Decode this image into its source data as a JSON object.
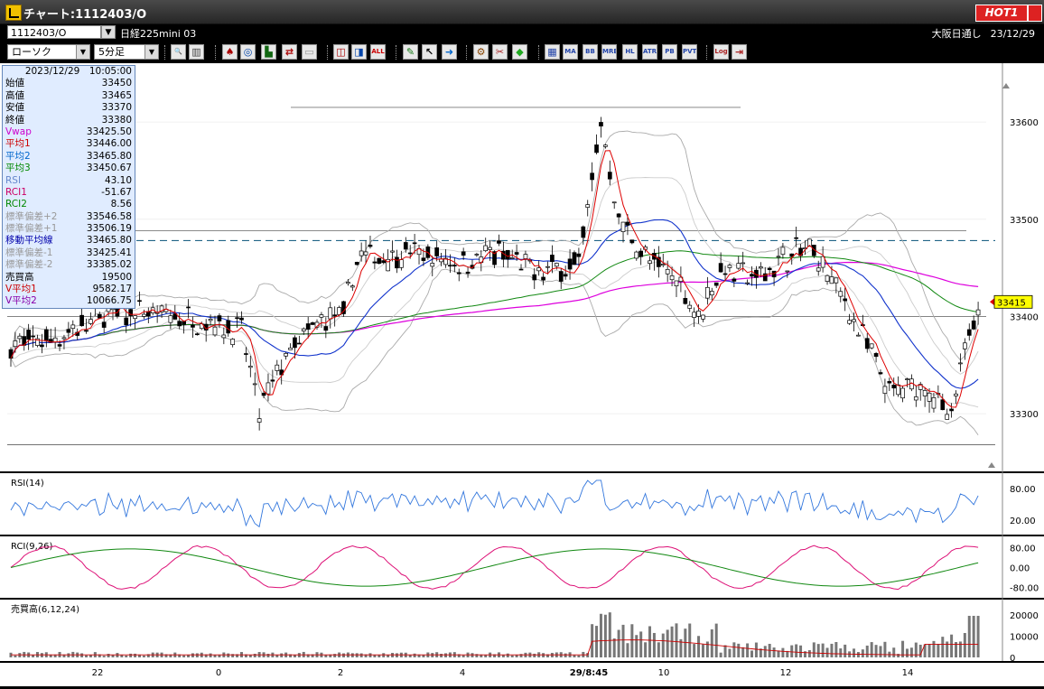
{
  "window": {
    "title": "チャート:1112403/O",
    "hot_label": "HOT1"
  },
  "header": {
    "code": "1112403/O",
    "name": "日経225mini 03",
    "market": "大阪日通し",
    "date": "23/12/29"
  },
  "toolbar": {
    "chart_type": "ローソク",
    "timeframe": "5分足",
    "buttons": [
      {
        "name": "zoom-icon",
        "glyph": "🔍",
        "color": "#2255cc"
      },
      {
        "name": "split-icon",
        "glyph": "▥",
        "color": "#444"
      },
      {
        "name": "candle-tool-icon",
        "glyph": "♠",
        "color": "#aa0000"
      },
      {
        "name": "magnifier-info-icon",
        "glyph": "◎",
        "color": "#0044aa"
      },
      {
        "name": "bar-chart-icon",
        "glyph": "▙",
        "color": "#116611"
      },
      {
        "name": "shuffle-icon",
        "glyph": "⇄",
        "color": "#aa0000"
      },
      {
        "name": "disabled-icon",
        "glyph": "▭",
        "color": "#999"
      },
      {
        "name": "candle-up-icon",
        "glyph": "◫",
        "color": "#aa0000"
      },
      {
        "name": "candle-down-icon",
        "glyph": "◨",
        "color": "#0044aa"
      },
      {
        "name": "all-icon",
        "glyph": "ALL",
        "color": "#cc0000"
      },
      {
        "name": "pen-icon",
        "glyph": "✎",
        "color": "#117711"
      },
      {
        "name": "cursor-icon",
        "glyph": "↖",
        "color": "#000"
      },
      {
        "name": "arrow-right-icon",
        "glyph": "➜",
        "color": "#0066cc"
      },
      {
        "name": "settings-icon",
        "glyph": "⚙",
        "color": "#884400"
      },
      {
        "name": "wrench-icon",
        "glyph": "✂",
        "color": "#aa2222"
      },
      {
        "name": "color-icon",
        "glyph": "◆",
        "color": "#22aa22"
      },
      {
        "name": "grid-icon",
        "glyph": "▦",
        "color": "#2244aa"
      },
      {
        "name": "ma-icon",
        "glyph": "MA",
        "color": "#2244aa"
      },
      {
        "name": "bb-icon",
        "glyph": "BB",
        "color": "#2244aa"
      },
      {
        "name": "mre-icon",
        "glyph": "MRE",
        "color": "#2244aa"
      },
      {
        "name": "hl-icon",
        "glyph": "HL",
        "color": "#2244aa"
      },
      {
        "name": "atr-icon",
        "glyph": "ATR",
        "color": "#2244aa"
      },
      {
        "name": "pb-icon",
        "glyph": "PB",
        "color": "#2244aa"
      },
      {
        "name": "pvt-icon",
        "glyph": "PVT",
        "color": "#2244aa"
      },
      {
        "name": "log-icon",
        "glyph": "Log",
        "color": "#aa2222"
      },
      {
        "name": "exit-icon",
        "glyph": "⇥",
        "color": "#aa2222"
      }
    ]
  },
  "info_panel": {
    "datetime": "2023/12/29　10:05:00",
    "rows": [
      {
        "label": "始値",
        "value": "33450",
        "color": "#000000"
      },
      {
        "label": "高値",
        "value": "33465",
        "color": "#000000"
      },
      {
        "label": "安値",
        "value": "33370",
        "color": "#000000"
      },
      {
        "label": "終値",
        "value": "33380",
        "color": "#000000"
      },
      {
        "label": "Vwap",
        "value": "33425.50",
        "color": "#cc00cc"
      },
      {
        "label": "平均1",
        "value": "33446.00",
        "color": "#cc0000"
      },
      {
        "label": "平均2",
        "value": "33465.80",
        "color": "#0066cc"
      },
      {
        "label": "平均3",
        "value": "33450.67",
        "color": "#008800"
      },
      {
        "label": "RSI",
        "value": "43.10",
        "color": "#6688cc"
      },
      {
        "label": "RCI1",
        "value": "-51.67",
        "color": "#cc0066"
      },
      {
        "label": "RCI2",
        "value": "8.56",
        "color": "#008800"
      },
      {
        "label": "標準偏差+2",
        "value": "33546.58",
        "color": "#999999"
      },
      {
        "label": "標準偏差+1",
        "value": "33506.19",
        "color": "#999999"
      },
      {
        "label": "移動平均線",
        "value": "33465.80",
        "color": "#0000aa"
      },
      {
        "label": "標準偏差-1",
        "value": "33425.41",
        "color": "#999999"
      },
      {
        "label": "標準偏差-2",
        "value": "33385.02",
        "color": "#999999"
      },
      {
        "label": "売買高",
        "value": "19500",
        "color": "#000000"
      },
      {
        "label": "V平均1",
        "value": "9582.17",
        "color": "#cc0000"
      },
      {
        "label": "V平均2",
        "value": "10066.75",
        "color": "#8800aa"
      }
    ]
  },
  "price_axis": {
    "ticks": [
      "33600",
      "33500",
      "33400",
      "33300"
    ],
    "current_price": "33415"
  },
  "panels": {
    "rsi": {
      "label": "RSI(14)",
      "ticks": [
        "80.00",
        "20.00"
      ]
    },
    "rci": {
      "label": "RCI(9,26)",
      "ticks": [
        "80.00",
        "0.00",
        "-80.00"
      ]
    },
    "volume": {
      "label": "売買高(6,12,24)",
      "ticks": [
        "20000",
        "10000",
        "0"
      ]
    }
  },
  "time_axis": {
    "ticks": [
      "22",
      "0",
      "2",
      "4",
      "29/8:45",
      "10",
      "12",
      "14"
    ]
  },
  "chart_data": {
    "type": "candlestick",
    "symbol": "1112403/O",
    "timeframe": "5分足",
    "price_range": [
      33250,
      33640
    ],
    "price_ticks": [
      33300,
      33400,
      33500,
      33600
    ],
    "current_price": 33415,
    "dashed_level": 33478,
    "rsi_ticks": [
      20,
      80
    ],
    "rci_ticks": [
      -80,
      0,
      80
    ],
    "volume_ticks": [
      0,
      10000,
      20000
    ],
    "x_labels": [
      "22",
      "0",
      "2",
      "4",
      "29/8:45",
      "10",
      "12",
      "14"
    ]
  }
}
